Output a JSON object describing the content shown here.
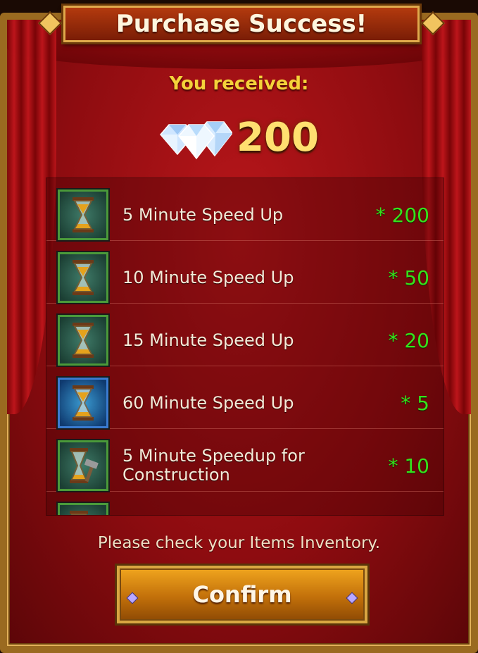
{
  "dialog": {
    "title": "Purchase Success!",
    "received_label": "You received:",
    "gems_amount": "200",
    "note": "Please check your Items Inventory.",
    "confirm_label": "Confirm"
  },
  "items": [
    {
      "name": "5 Minute Speed Up",
      "qty": "* 200",
      "icon": "hourglass-icon",
      "frame": "green"
    },
    {
      "name": "10 Minute Speed Up",
      "qty": "* 50",
      "icon": "hourglass-icon",
      "frame": "green"
    },
    {
      "name": "15 Minute Speed Up",
      "qty": "* 20",
      "icon": "hourglass-icon",
      "frame": "green"
    },
    {
      "name": "60 Minute Speed Up",
      "qty": "* 5",
      "icon": "hourglass-icon",
      "frame": "blue"
    },
    {
      "name": "5 Minute Speedup for Construction",
      "qty": "* 10",
      "icon": "hourglass-hammer-icon",
      "frame": "green"
    }
  ],
  "colors": {
    "background_red": "#8e0c10",
    "gold": "#f4d23a",
    "quantity_green": "#35e21c"
  }
}
